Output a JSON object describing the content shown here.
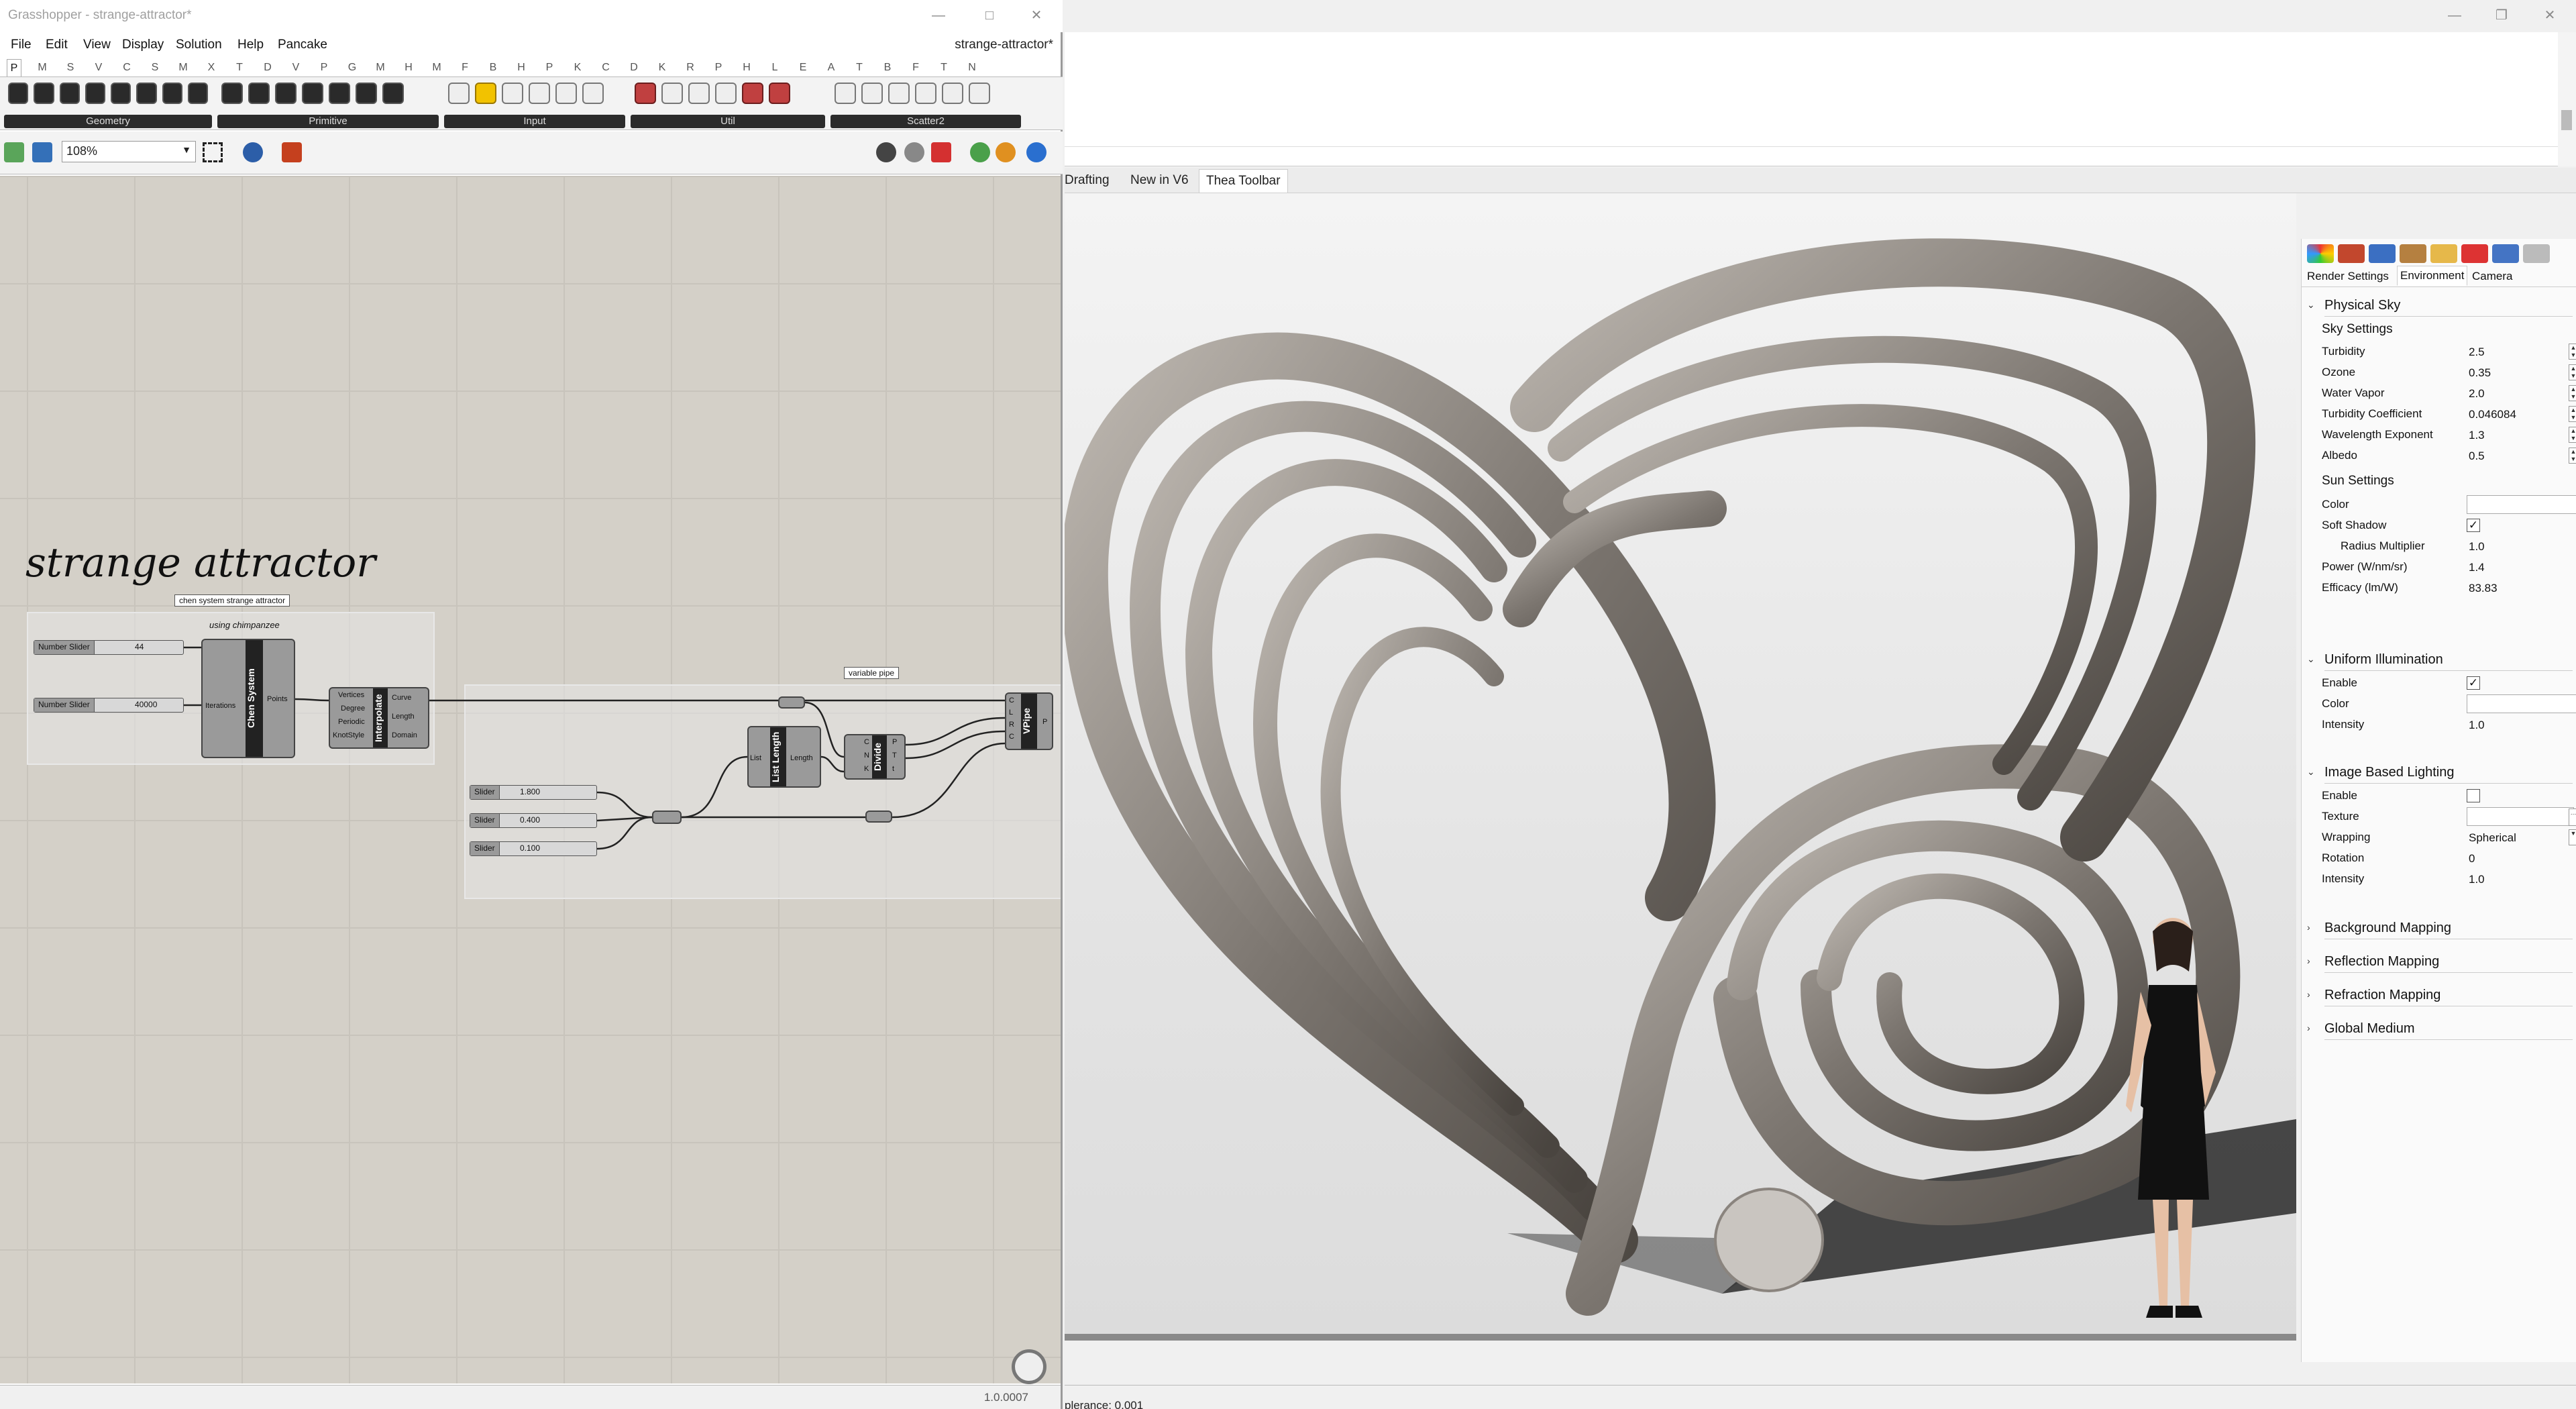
{
  "grasshopper": {
    "title": "Grasshopper - strange-attractor*",
    "menu": [
      "File",
      "Edit",
      "View",
      "Display",
      "Solution",
      "Help",
      "Pancake"
    ],
    "document_name": "strange-attractor*",
    "ribbon_tabs": [
      "P",
      "M",
      "S",
      "V",
      "C",
      "S",
      "M",
      "X",
      "T",
      "D",
      "V",
      "P",
      "G",
      "M",
      "H",
      "M",
      "F",
      "B",
      "H",
      "P",
      "K",
      "C",
      "D",
      "K",
      "R",
      "P",
      "H",
      "L",
      "E",
      "A",
      "T",
      "B",
      "F",
      "T",
      "N"
    ],
    "ribbon_groups": [
      "Geometry",
      "Primitive",
      "Input",
      "Util",
      "Scatter2"
    ],
    "zoom": "108%",
    "canvas_title": "strange attractor",
    "group_tags": {
      "chen": "chen system strange attractor",
      "pipe": "variable pipe"
    },
    "group_label": "using chimpanzee",
    "sliders": [
      {
        "name": "Number Slider",
        "value": "44"
      },
      {
        "name": "Number Slider",
        "value": "40000"
      },
      {
        "name": "Slider",
        "value": "1.800"
      },
      {
        "name": "Slider",
        "value": "0.400"
      },
      {
        "name": "Slider",
        "value": "0.100"
      }
    ],
    "components": {
      "chen": {
        "label": "Chen System",
        "out": "Points",
        "in_iter": "Iterations"
      },
      "interpolate": {
        "label": "Interpolate",
        "inputs": [
          "Vertices",
          "Degree",
          "Periodic",
          "KnotStyle"
        ],
        "outputs": [
          "Curve",
          "Length",
          "Domain"
        ]
      },
      "list_length": {
        "label": "List Length",
        "in": "List",
        "out": "Length"
      },
      "divide": {
        "label": "Divide",
        "inputs": [
          "C",
          "N",
          "K"
        ],
        "outputs": [
          "P",
          "T",
          "t"
        ]
      },
      "vpipe": {
        "label": "VPipe",
        "inputs": [
          "C",
          "L",
          "R",
          "C"
        ],
        "outputs": [
          "P"
        ]
      }
    },
    "version": "1.0.0007"
  },
  "rhino": {
    "toolbar_tabs": [
      "Drafting",
      "New in V6",
      "Thea Toolbar"
    ],
    "status_text": "plerance: 0.001"
  },
  "properties": {
    "tabs": [
      "Render Settings",
      "Environment",
      "Camera"
    ],
    "physical_sky": "Physical Sky",
    "sky_settings": "Sky Settings",
    "sky": [
      {
        "label": "Turbidity",
        "value": "2.5"
      },
      {
        "label": "Ozone",
        "value": "0.35"
      },
      {
        "label": "Water Vapor",
        "value": "2.0"
      },
      {
        "label": "Turbidity Coefficient",
        "value": "0.046084"
      },
      {
        "label": "Wavelength Exponent",
        "value": "1.3"
      },
      {
        "label": "Albedo",
        "value": "0.5"
      }
    ],
    "sun_settings": "Sun Settings",
    "sun": {
      "color": "Color",
      "soft_shadow": "Soft Shadow",
      "radius_multiplier": "Radius Multiplier",
      "radius_value": "1.0",
      "power": "Power (W/nm/sr)",
      "power_value": "1.4",
      "efficacy": "Efficacy (lm/W)",
      "efficacy_value": "83.83"
    },
    "uniform": {
      "title": "Uniform Illumination",
      "enable": "Enable",
      "color": "Color",
      "intensity": "Intensity",
      "intensity_value": "1.0"
    },
    "ibl": {
      "title": "Image Based Lighting",
      "enable": "Enable",
      "texture": "Texture",
      "wrapping": "Wrapping",
      "wrapping_value": "Spherical",
      "rotation": "Rotation",
      "rotation_value": "0",
      "intensity": "Intensity",
      "intensity_value": "1.0"
    },
    "collapsed": [
      "Background Mapping",
      "Reflection Mapping",
      "Refraction Mapping",
      "Global Medium"
    ]
  },
  "icons": [
    "minimize-icon",
    "maximize-icon",
    "close-icon",
    "checkbox-checked-icon",
    "chevron-down-icon"
  ]
}
